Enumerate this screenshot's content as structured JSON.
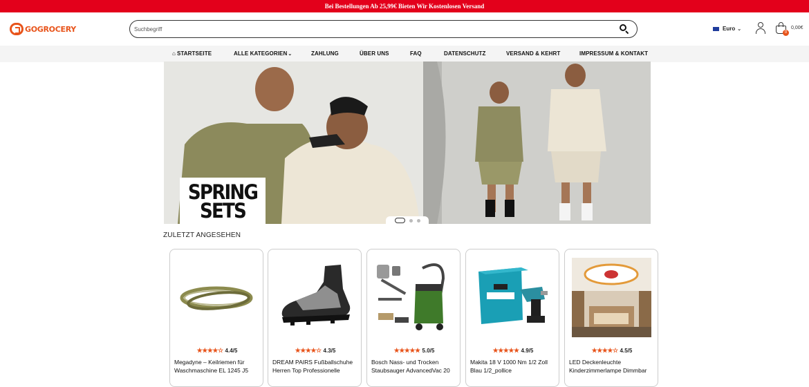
{
  "topbar": {
    "text": "Bei Bestellungen Ab 25,99€ Bieten Wir Kostenlosen Versand"
  },
  "header": {
    "logo_text": "GOGROCERY",
    "search_placeholder": "Suchbegriff",
    "currency": "Euro",
    "cart_count": "0",
    "cart_total": "0,00€"
  },
  "nav": {
    "items": [
      {
        "label": "STARTSEITE"
      },
      {
        "label": "ALLE KATEGORIEN"
      },
      {
        "label": "ZAHLUNG"
      },
      {
        "label": "ÜBER UNS"
      },
      {
        "label": "FAQ"
      },
      {
        "label": "DATENSCHUTZ"
      },
      {
        "label": "VERSAND & KEHRT"
      },
      {
        "label": "IMPRESSUM & KONTAKT"
      }
    ]
  },
  "hero": {
    "line1": "SPRING",
    "line2": "SETS",
    "slide_count": 3,
    "active_slide": 1
  },
  "recent": {
    "title": "ZULETZT ANGESEHEN",
    "products": [
      {
        "rating": "4.4/5",
        "stars": 4.4,
        "title": "Megadyne – Keilriemen für Waschmaschine EL 1245 J5",
        "icon": "belt-image"
      },
      {
        "rating": "4.3/5",
        "stars": 4.3,
        "title": "DREAM PAIRS Fußballschuhe Herren Top Professionelle",
        "icon": "football-boot-image"
      },
      {
        "rating": "5.0/5",
        "stars": 5.0,
        "title": "Bosch Nass- und Trocken Staubsauger AdvancedVac 20",
        "icon": "vacuum-image"
      },
      {
        "rating": "4.9/5",
        "stars": 4.9,
        "title": "Makita 18 V 1000 Nm 1/2 Zoll Blau 1/2_pollice",
        "icon": "impact-wrench-image"
      },
      {
        "rating": "4.5/5",
        "stars": 4.5,
        "title": "LED Deckenleuchte Kinderzimmerlampe Dimmbar",
        "icon": "ceiling-lamp-image"
      }
    ]
  },
  "colors": {
    "accent": "#e8541b",
    "topbar": "#e3001b"
  }
}
